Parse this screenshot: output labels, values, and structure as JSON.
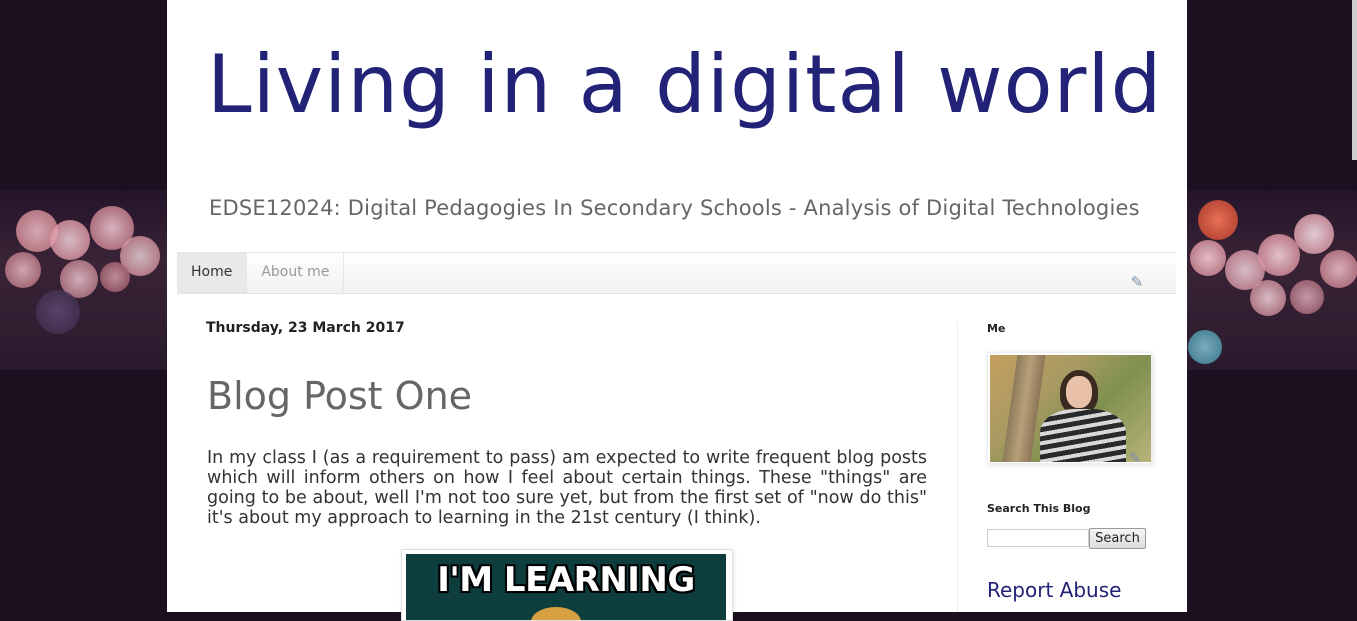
{
  "header": {
    "title": "Living in a digital world",
    "description": "EDSE12024: Digital Pedagogies In Secondary Schools - Analysis of Digital Technologies"
  },
  "nav": {
    "tabs": [
      {
        "label": "Home",
        "active": true
      },
      {
        "label": "About me",
        "active": false
      }
    ]
  },
  "post": {
    "date": "Thursday, 23 March 2017",
    "title": "Blog Post One",
    "body": "In my class I (as a requirement to pass) am expected to write frequent blog posts which will inform others on how I feel about certain things. These \"things\" are going to be about, well I'm not too sure yet, but from the first set of \"now do this\" it's about my approach to learning in the 21st century (I think).",
    "image_caption": "I'M LEARNING"
  },
  "sidebar": {
    "profile_title": "Me",
    "search_title": "Search This Blog",
    "search_placeholder": "",
    "search_button": "Search",
    "report_title": "Report Abuse"
  },
  "colors": {
    "title": "#222277",
    "background": "#1c1020",
    "page": "#ffffff"
  }
}
